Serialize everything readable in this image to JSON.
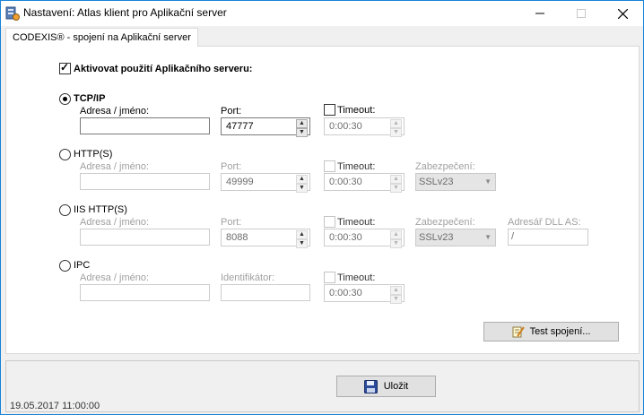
{
  "window": {
    "title": "Nastavení: Atlas klient pro Aplikační server",
    "min_label": "—",
    "max_label": "☐",
    "close_label": "✕"
  },
  "tab": {
    "label": "CODEXIS® - spojení na Aplikační server"
  },
  "activate": {
    "label": "Aktivovat použití Aplikačního serveru:",
    "checked": true
  },
  "tcpip": {
    "label": "TCP/IP",
    "address_label": "Adresa / jméno:",
    "address_value": "",
    "port_label": "Port:",
    "port_value": "47777",
    "timeout_label": "Timeout:",
    "timeout_value": "0:00:30"
  },
  "https": {
    "label": "HTTP(S)",
    "address_label": "Adresa / jméno:",
    "address_value": "",
    "port_label": "Port:",
    "port_value": "49999",
    "timeout_label": "Timeout:",
    "timeout_value": "0:00:30",
    "security_label": "Zabezpečení:",
    "security_value": "SSLv23"
  },
  "iis": {
    "label": "IIS HTTP(S)",
    "address_label": "Adresa / jméno:",
    "address_value": "",
    "port_label": "Port:",
    "port_value": "8088",
    "timeout_label": "Timeout:",
    "timeout_value": "0:00:30",
    "security_label": "Zabezpečení:",
    "security_value": "SSLv23",
    "dll_label": "Adresář DLL AS:",
    "dll_value": "/"
  },
  "ipc": {
    "label": "IPC",
    "address_label": "Adresa / jméno:",
    "address_value": "",
    "ident_label": "Identifikátor:",
    "ident_value": "",
    "timeout_label": "Timeout:",
    "timeout_value": "0:00:30"
  },
  "buttons": {
    "test_label": "Test spojení...",
    "save_label": "Uložit"
  },
  "status": {
    "timestamp": "19.05.2017 11:00:00"
  },
  "icons": {
    "app": "server-settings-icon",
    "test": "pencil-note-icon",
    "save": "floppy-disk-icon"
  }
}
